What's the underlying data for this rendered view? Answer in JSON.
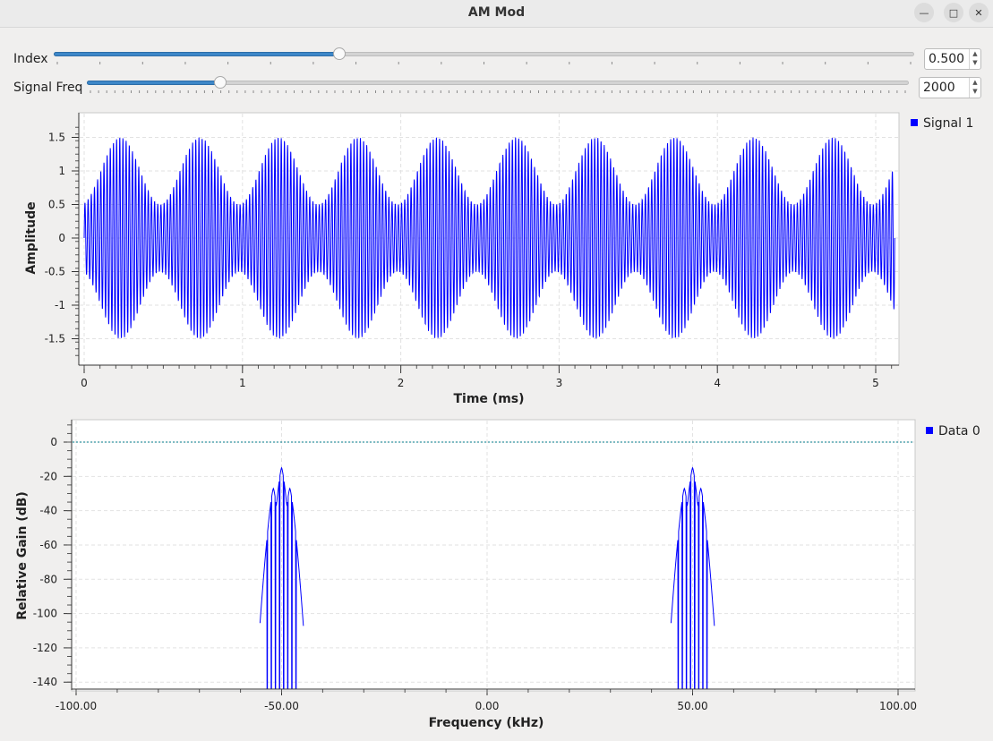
{
  "window": {
    "title": "AM Mod"
  },
  "controls": {
    "index": {
      "label": "Index",
      "value": "0.500",
      "fraction": 0.332
    },
    "signal_freq": {
      "label": "Signal Freq",
      "value": "2000",
      "fraction": 0.162
    }
  },
  "time_plot": {
    "ylabel": "Amplitude",
    "xlabel": "Time (ms)",
    "legend": "Signal 1",
    "yticks": [
      "1.5",
      "1",
      "0.5",
      "0",
      "-0.5",
      "-1",
      "-1.5"
    ],
    "xticks": [
      "0",
      "1",
      "2",
      "3",
      "4",
      "5"
    ],
    "line_color": "#0000ff"
  },
  "freq_plot": {
    "ylabel": "Relative Gain (dB)",
    "xlabel": "Frequency (kHz)",
    "legend": "Data 0",
    "yticks": [
      "0",
      "-20",
      "-40",
      "-60",
      "-80",
      "-100",
      "-120",
      "-140"
    ],
    "xticks": [
      "-100.00",
      "-50.00",
      "0.00",
      "50.00",
      "100.00"
    ],
    "line_color": "#0000ff"
  },
  "chart_data": [
    {
      "type": "line",
      "xlabel": "Time (ms)",
      "ylabel": "Amplitude",
      "xlim": [
        0,
        5.12
      ],
      "ylim": [
        -1.75,
        1.75
      ],
      "grid": true,
      "legend_position": "top-right",
      "series": [
        {
          "name": "Signal 1",
          "description_values": {
            "carrier_khz": 50,
            "modulation_hz": 2000,
            "modulation_index": 0.5,
            "envelope_max": 1.5,
            "envelope_min": 0.5
          }
        }
      ]
    },
    {
      "type": "line",
      "xlabel": "Frequency (kHz)",
      "ylabel": "Relative Gain (dB)",
      "xlim": [
        -100,
        100
      ],
      "ylim": [
        -140,
        10
      ],
      "grid": true,
      "legend_position": "top-right",
      "series": [
        {
          "name": "Data 0",
          "peaks": [
            {
              "x": -52,
              "y": -27
            },
            {
              "x": -50,
              "y": -15
            },
            {
              "x": -48,
              "y": -27
            },
            {
              "x": 48,
              "y": -27
            },
            {
              "x": 50,
              "y": -15
            },
            {
              "x": 52,
              "y": -27
            }
          ]
        }
      ]
    }
  ]
}
